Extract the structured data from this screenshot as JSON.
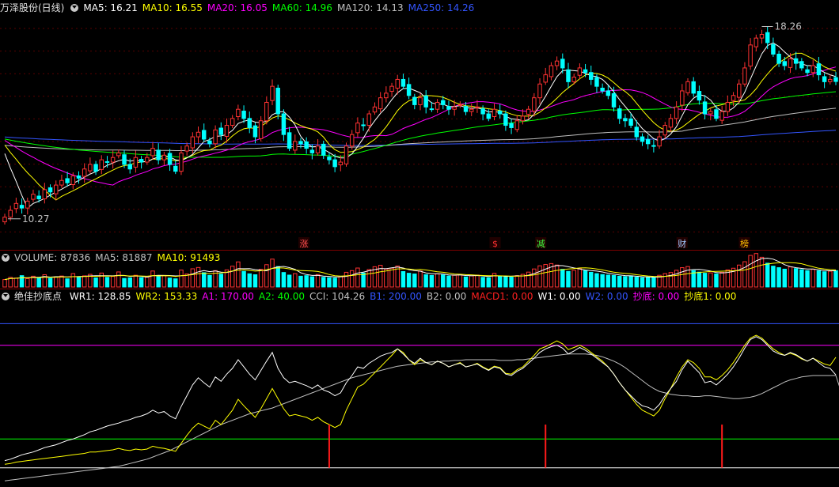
{
  "title": "万泽股份(日线)",
  "ma_labels": [
    {
      "text": "MA5: 16.21",
      "color": "#ffffff"
    },
    {
      "text": "MA10: 16.55",
      "color": "#ffff00"
    },
    {
      "text": "MA20: 16.05",
      "color": "#ff00ff"
    },
    {
      "text": "MA60: 14.96",
      "color": "#00ff00"
    },
    {
      "text": "MA120: 14.13",
      "color": "#c0c0c0"
    },
    {
      "text": "MA250: 14.26",
      "color": "#3355ff"
    }
  ],
  "price_high_label": "18.26",
  "price_low_label": "10.27",
  "event_markers": [
    {
      "text": "涨",
      "color": "#ff5050"
    },
    {
      "text": "$",
      "color": "#ff3030"
    },
    {
      "text": "减",
      "color": "#40ff40"
    },
    {
      "text": "财",
      "color": "#9fc8ff"
    },
    {
      "text": "榜",
      "color": "#ffc000"
    }
  ],
  "volume_labels": [
    {
      "text": "VOLUME: 87836",
      "color": "#c0c0c0"
    },
    {
      "text": "MA5: 81887",
      "color": "#c0c0c0"
    },
    {
      "text": "MA10: 91493",
      "color": "#ffff00"
    }
  ],
  "indicator_title": "绝佳抄底点",
  "indicator_labels": [
    {
      "text": "WR1: 128.85",
      "color": "#ffffff"
    },
    {
      "text": "WR2: 153.33",
      "color": "#ffff00"
    },
    {
      "text": "A1: 170.00",
      "color": "#ff00ff"
    },
    {
      "text": "A2: 40.00",
      "color": "#00ff00"
    },
    {
      "text": "CCI: 104.26",
      "color": "#c0c0c0"
    },
    {
      "text": "B1: 200.00",
      "color": "#3355ff"
    },
    {
      "text": "B2: 0.00",
      "color": "#c0c0c0"
    },
    {
      "text": "MACD1: 0.00",
      "color": "#ff2020"
    },
    {
      "text": "W1: 0.00",
      "color": "#ffffff"
    },
    {
      "text": "W2: 0.00",
      "color": "#3355ff"
    },
    {
      "text": "抄底: 0.00",
      "color": "#ff00ff"
    },
    {
      "text": "抄底1: 0.00",
      "color": "#ffff00"
    }
  ],
  "chart_data": {
    "type": "candlestick",
    "price": {
      "ylim": [
        9.5,
        19.0
      ],
      "closes": [
        10.3,
        10.6,
        10.9,
        10.7,
        11.0,
        11.3,
        11.1,
        11.5,
        11.4,
        11.7,
        11.9,
        11.8,
        12.1,
        12.0,
        12.4,
        12.6,
        12.3,
        12.8,
        12.7,
        12.9,
        13.1,
        12.6,
        12.4,
        12.9,
        12.7,
        12.9,
        13.3,
        12.8,
        13.0,
        12.6,
        12.3,
        13.1,
        13.4,
        13.8,
        14.0,
        13.7,
        13.5,
        14.1,
        13.9,
        14.3,
        14.6,
        15.0,
        14.6,
        14.2,
        13.8,
        14.5,
        15.3,
        16.0,
        14.8,
        13.9,
        13.3,
        13.6,
        13.5,
        13.3,
        13.1,
        13.4,
        13.0,
        12.8,
        12.5,
        12.7,
        13.4,
        13.9,
        14.4,
        14.3,
        14.8,
        15.1,
        15.5,
        15.7,
        16.0,
        16.3,
        16.0,
        15.6,
        15.2,
        15.5,
        15.1,
        15.0,
        15.3,
        15.2,
        15.0,
        15.1,
        15.2,
        14.9,
        15.0,
        15.1,
        14.8,
        14.6,
        15.0,
        14.8,
        14.3,
        14.2,
        14.5,
        14.7,
        15.0,
        15.5,
        16.1,
        16.5,
        16.9,
        17.1,
        16.8,
        16.2,
        16.4,
        16.8,
        16.6,
        16.3,
        16.0,
        15.8,
        15.6,
        15.1,
        14.6,
        14.5,
        14.3,
        13.8,
        13.6,
        13.5,
        13.4,
        13.8,
        14.3,
        14.6,
        15.1,
        15.8,
        16.2,
        15.7,
        15.4,
        14.8,
        14.9,
        14.6,
        14.9,
        15.3,
        15.6,
        16.1,
        16.8,
        17.8,
        18.1,
        18.26,
        17.9,
        17.4,
        17.0,
        16.9,
        17.2,
        17.0,
        16.8,
        16.6,
        16.9,
        16.5,
        16.2,
        16.3,
        16.21
      ]
    },
    "volume": {
      "ylim": [
        0,
        200000
      ],
      "values": [
        40000,
        52000,
        48000,
        61000,
        45000,
        58000,
        50000,
        66000,
        47000,
        55000,
        59000,
        44000,
        72000,
        53000,
        60000,
        68000,
        49000,
        75000,
        52000,
        57000,
        81000,
        46000,
        49000,
        63000,
        51000,
        54000,
        86000,
        58000,
        62000,
        48000,
        44000,
        91000,
        70000,
        98000,
        105000,
        77000,
        62000,
        88000,
        69000,
        92000,
        112000,
        135000,
        84000,
        71000,
        66000,
        95000,
        120000,
        150000,
        110000,
        78000,
        64000,
        72000,
        58000,
        61000,
        55000,
        67000,
        52000,
        50000,
        48000,
        57000,
        79000,
        88000,
        102000,
        75000,
        94000,
        109000,
        117000,
        96000,
        101000,
        113000,
        83000,
        74000,
        70000,
        86000,
        66000,
        62000,
        71000,
        65000,
        59000,
        63000,
        68000,
        54000,
        60000,
        64000,
        52000,
        50000,
        73000,
        58000,
        55000,
        53000,
        61000,
        68000,
        80000,
        97000,
        114000,
        121000,
        126000,
        118000,
        95000,
        84000,
        90000,
        99000,
        88000,
        79000,
        72000,
        67000,
        64000,
        62000,
        58000,
        56000,
        60000,
        53000,
        50000,
        51000,
        49000,
        63000,
        72000,
        78000,
        90000,
        104000,
        110000,
        88000,
        80000,
        74000,
        76000,
        70000,
        79000,
        92000,
        101000,
        118000,
        136000,
        170000,
        180000,
        160000,
        128000,
        112000,
        104000,
        96000,
        108000,
        99000,
        93000,
        88000,
        95000,
        87000,
        82000,
        85000,
        87836
      ]
    },
    "indicator": {
      "ylim": [
        -20,
        230
      ],
      "WR1": [
        10,
        12,
        15,
        18,
        20,
        22,
        25,
        28,
        30,
        32,
        35,
        38,
        40,
        43,
        46,
        50,
        52,
        55,
        58,
        60,
        62,
        65,
        67,
        70,
        72,
        75,
        80,
        76,
        78,
        72,
        68,
        85,
        100,
        115,
        125,
        118,
        112,
        126,
        120,
        130,
        138,
        150,
        140,
        130,
        122,
        135,
        148,
        160,
        138,
        125,
        118,
        120,
        117,
        114,
        110,
        115,
        108,
        105,
        100,
        104,
        118,
        128,
        140,
        138,
        145,
        150,
        155,
        158,
        160,
        165,
        158,
        150,
        145,
        152,
        146,
        143,
        148,
        145,
        140,
        143,
        145,
        140,
        142,
        144,
        139,
        135,
        140,
        138,
        130,
        128,
        134,
        138,
        145,
        152,
        160,
        165,
        168,
        170,
        166,
        158,
        162,
        167,
        163,
        158,
        152,
        146,
        140,
        130,
        118,
        108,
        100,
        92,
        86,
        84,
        80,
        88,
        100,
        110,
        120,
        136,
        148,
        140,
        132,
        118,
        120,
        115,
        122,
        130,
        140,
        152,
        166,
        178,
        182,
        178,
        170,
        162,
        158,
        156,
        160,
        157,
        152,
        148,
        152,
        146,
        140,
        138,
        128.85
      ],
      "WR2": [
        5,
        6,
        8,
        9,
        10,
        11,
        12,
        13,
        14,
        15,
        16,
        17,
        18,
        19,
        20,
        22,
        22,
        23,
        24,
        25,
        27,
        25,
        24,
        26,
        25,
        26,
        30,
        28,
        27,
        25,
        23,
        34,
        45,
        55,
        62,
        58,
        54,
        66,
        60,
        70,
        80,
        95,
        86,
        78,
        70,
        82,
        96,
        110,
        96,
        82,
        72,
        74,
        72,
        70,
        66,
        70,
        64,
        60,
        56,
        60,
        80,
        96,
        112,
        116,
        124,
        132,
        140,
        148,
        156,
        165,
        160,
        150,
        143,
        150,
        146,
        143,
        148,
        145,
        140,
        143,
        146,
        140,
        142,
        145,
        140,
        136,
        141,
        139,
        131,
        130,
        136,
        140,
        148,
        156,
        165,
        168,
        172,
        176,
        172,
        164,
        167,
        170,
        166,
        160,
        154,
        148,
        140,
        130,
        118,
        108,
        98,
        88,
        80,
        76,
        72,
        80,
        96,
        110,
        126,
        140,
        150,
        146,
        138,
        126,
        126,
        122,
        128,
        136,
        146,
        158,
        170,
        180,
        184,
        180,
        172,
        165,
        160,
        156,
        159,
        156,
        151,
        148,
        152,
        148,
        144,
        142,
        153.33
      ],
      "CCI": [
        -18,
        -17,
        -16,
        -15,
        -14,
        -13,
        -12,
        -11,
        -10,
        -9,
        -8,
        -7,
        -6,
        -5,
        -4,
        -3,
        -2,
        -1,
        0,
        1,
        2,
        4,
        6,
        8,
        10,
        12,
        15,
        18,
        21,
        24,
        28,
        32,
        36,
        40,
        44,
        48,
        52,
        56,
        60,
        63,
        66,
        69,
        72,
        75,
        77,
        79,
        81,
        83,
        86,
        89,
        92,
        95,
        98,
        101,
        104,
        107,
        110,
        113,
        116,
        119,
        122,
        125,
        127,
        129,
        131,
        133,
        135,
        137,
        139,
        141,
        142,
        143,
        144,
        145,
        146,
        147,
        147,
        148,
        148,
        149,
        149,
        150,
        150,
        150,
        150,
        150,
        150,
        149,
        149,
        149,
        150,
        150,
        151,
        152,
        153,
        154,
        155,
        156,
        157,
        158,
        158,
        158,
        158,
        157,
        156,
        154,
        151,
        148,
        144,
        139,
        133,
        127,
        121,
        115,
        110,
        106,
        104,
        102,
        101,
        100,
        100,
        99,
        99,
        100,
        100,
        99,
        98,
        97,
        96,
        96,
        97,
        98,
        100,
        103,
        107,
        111,
        115,
        119,
        122,
        124,
        126,
        127,
        128,
        128,
        128,
        128,
        128,
        104.26
      ],
      "A1": 170,
      "A2": 40,
      "B1": 200,
      "B2": 0,
      "signals": [
        57,
        95,
        126
      ]
    }
  }
}
